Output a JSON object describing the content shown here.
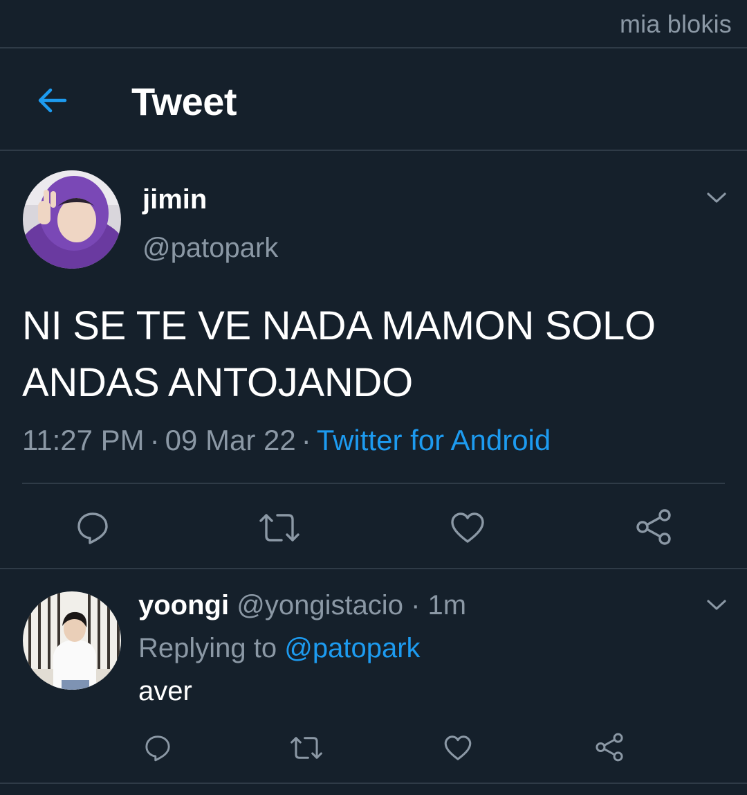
{
  "status": {
    "label": "mia blokis"
  },
  "header": {
    "title": "Tweet",
    "back_icon": "arrow-left-icon"
  },
  "tweet": {
    "name": "jimin",
    "handle": "@patopark",
    "text_line1": "NI SE TE VE NADA MAMON SOLO",
    "text_line2": "ANDAS ANTOJANDO",
    "time": "11:27 PM",
    "sep": "·",
    "date": "09 Mar 22",
    "source": "Twitter for Android",
    "actions": [
      "reply-icon",
      "retweet-icon",
      "like-icon",
      "share-icon"
    ]
  },
  "reply": {
    "name": "yoongi",
    "handle": "@yongistacio",
    "sep": "·",
    "age": "1m",
    "replying_prefix": "Replying to",
    "replying_handle": "@patopark",
    "text": "aver",
    "actions": [
      "reply-icon",
      "retweet-icon",
      "like-icon",
      "share-icon"
    ]
  },
  "colors": {
    "background": "#15202b",
    "divider": "#2f3b47",
    "text": "#ffffff",
    "muted": "#8b98a5",
    "accent": "#1d9bf0"
  }
}
